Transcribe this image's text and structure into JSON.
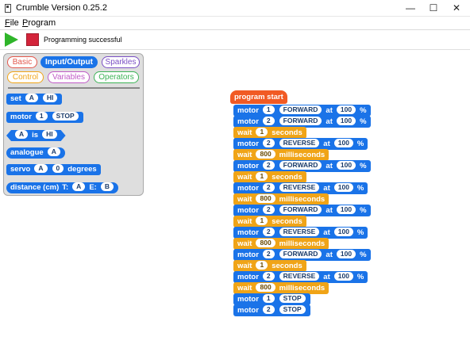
{
  "window": {
    "title": "Crumble Version 0.25.2",
    "controls": {
      "minimize": "—",
      "maximize": "☐",
      "close": "✕"
    }
  },
  "menu": {
    "file": {
      "accel": "F",
      "rest": "ile"
    },
    "program": {
      "accel": "P",
      "rest": "rogram"
    }
  },
  "toolbar": {
    "status": "Programming successful",
    "play_icon": "play-icon",
    "stop_icon": "stop-icon"
  },
  "colors": {
    "block_blue": "#1a73e8",
    "block_orange": "#f0a417",
    "hat_red": "#f15a24"
  },
  "palette": {
    "categories": [
      {
        "label": "Basic",
        "color": "#e2574c"
      },
      {
        "label": "Input/Output",
        "color": "#1a73e8",
        "active": true
      },
      {
        "label": "Sparkles",
        "color": "#7a4fc4"
      },
      {
        "label": "Control",
        "color": "#f0a417"
      },
      {
        "label": "Variables",
        "color": "#c05bc7"
      },
      {
        "label": "Operators",
        "color": "#3cb356"
      }
    ],
    "blocks": [
      {
        "parts": [
          "set",
          "A",
          "HI"
        ]
      },
      {
        "parts": [
          "motor",
          "1",
          "STOP"
        ]
      },
      {
        "parts": [
          "A",
          "is",
          "HI"
        ]
      },
      {
        "parts": [
          "analogue",
          "A"
        ]
      },
      {
        "parts": [
          "servo",
          "A",
          "0",
          "degrees"
        ]
      },
      {
        "parts": [
          "distance (cm)",
          "T:",
          "A",
          "E:",
          "B"
        ]
      }
    ]
  },
  "program": {
    "start": "program start",
    "blocks": [
      {
        "kind": "motor",
        "motor": "1",
        "dir": "FORWARD",
        "at": "at",
        "speed": "100",
        "pct": "%"
      },
      {
        "kind": "motor",
        "motor": "2",
        "dir": "FORWARD",
        "at": "at",
        "speed": "100",
        "pct": "%"
      },
      {
        "kind": "wait",
        "value": "1",
        "unit": "seconds"
      },
      {
        "kind": "motor",
        "motor": "2",
        "dir": "REVERSE",
        "at": "at",
        "speed": "100",
        "pct": "%"
      },
      {
        "kind": "wait",
        "value": "800",
        "unit": "milliseconds"
      },
      {
        "kind": "motor",
        "motor": "2",
        "dir": "FORWARD",
        "at": "at",
        "speed": "100",
        "pct": "%"
      },
      {
        "kind": "wait",
        "value": "1",
        "unit": "seconds"
      },
      {
        "kind": "motor",
        "motor": "2",
        "dir": "REVERSE",
        "at": "at",
        "speed": "100",
        "pct": "%"
      },
      {
        "kind": "wait",
        "value": "800",
        "unit": "milliseconds"
      },
      {
        "kind": "motor",
        "motor": "2",
        "dir": "FORWARD",
        "at": "at",
        "speed": "100",
        "pct": "%"
      },
      {
        "kind": "wait",
        "value": "1",
        "unit": "seconds"
      },
      {
        "kind": "motor",
        "motor": "2",
        "dir": "REVERSE",
        "at": "at",
        "speed": "100",
        "pct": "%"
      },
      {
        "kind": "wait",
        "value": "800",
        "unit": "milliseconds"
      },
      {
        "kind": "motor",
        "motor": "2",
        "dir": "FORWARD",
        "at": "at",
        "speed": "100",
        "pct": "%"
      },
      {
        "kind": "wait",
        "value": "1",
        "unit": "seconds"
      },
      {
        "kind": "motor",
        "motor": "2",
        "dir": "REVERSE",
        "at": "at",
        "speed": "100",
        "pct": "%"
      },
      {
        "kind": "wait",
        "value": "800",
        "unit": "milliseconds"
      },
      {
        "kind": "stop",
        "motor": "1",
        "dir": "STOP"
      },
      {
        "kind": "stop",
        "motor": "2",
        "dir": "STOP"
      }
    ]
  }
}
